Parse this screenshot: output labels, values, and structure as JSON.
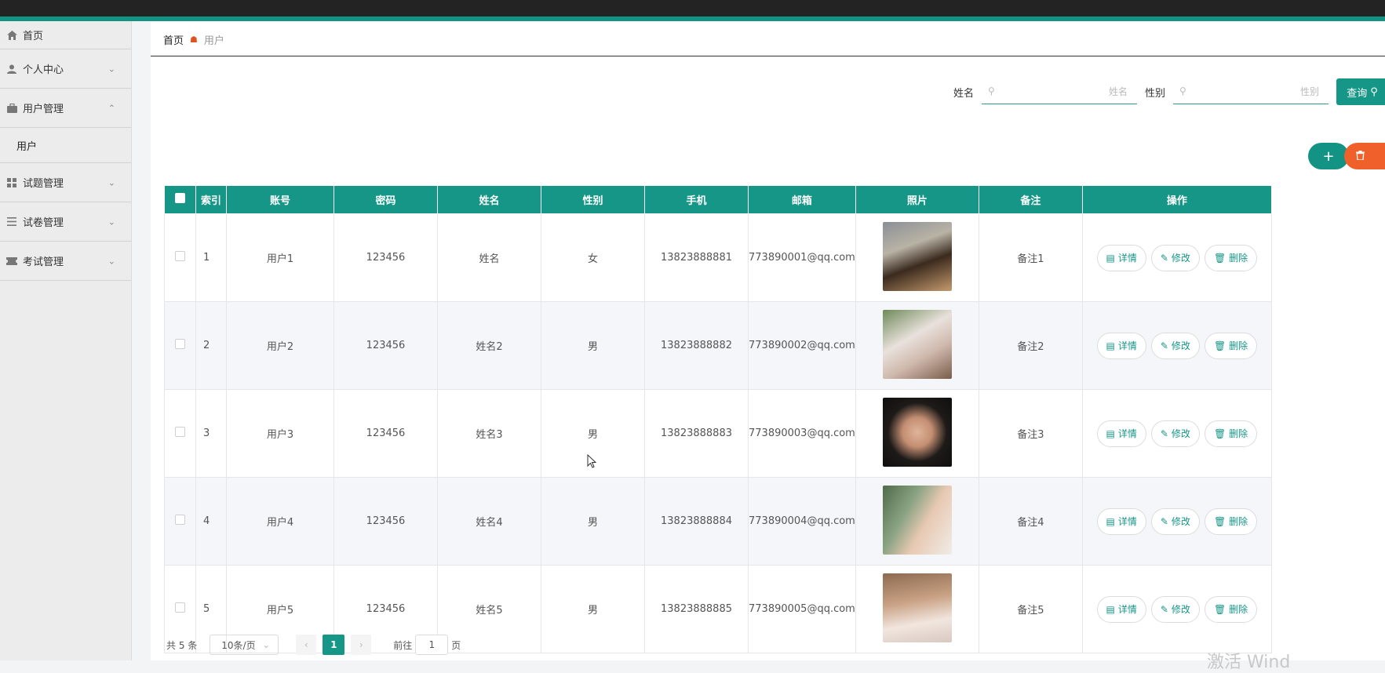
{
  "sidebar": {
    "home": "首页",
    "personal": "个人中心",
    "user_mgmt": "用户管理",
    "user_sub": "用户",
    "question_mgmt": "试题管理",
    "paper_mgmt": "试卷管理",
    "exam_mgmt": "考试管理"
  },
  "breadcrumb": {
    "home": "首页",
    "current": "用户"
  },
  "search": {
    "name_label": "姓名",
    "name_placeholder": "姓名",
    "gender_label": "性别",
    "gender_placeholder": "性别",
    "query_label": "查询"
  },
  "actions": {
    "add": "+"
  },
  "table": {
    "headers": [
      "索引",
      "账号",
      "密码",
      "姓名",
      "性别",
      "手机",
      "邮箱",
      "照片",
      "备注",
      "操作"
    ],
    "op_labels": {
      "detail": "详情",
      "edit": "修改",
      "delete": "删除"
    },
    "rows": [
      {
        "index": "1",
        "account": "用户1",
        "password": "123456",
        "name": "姓名",
        "gender": "女",
        "phone": "13823888881",
        "email": "773890001@qq.com",
        "remark": "备注1"
      },
      {
        "index": "2",
        "account": "用户2",
        "password": "123456",
        "name": "姓名2",
        "gender": "男",
        "phone": "13823888882",
        "email": "773890002@qq.com",
        "remark": "备注2"
      },
      {
        "index": "3",
        "account": "用户3",
        "password": "123456",
        "name": "姓名3",
        "gender": "男",
        "phone": "13823888883",
        "email": "773890003@qq.com",
        "remark": "备注3"
      },
      {
        "index": "4",
        "account": "用户4",
        "password": "123456",
        "name": "姓名4",
        "gender": "男",
        "phone": "13823888884",
        "email": "773890004@qq.com",
        "remark": "备注4"
      },
      {
        "index": "5",
        "account": "用户5",
        "password": "123456",
        "name": "姓名5",
        "gender": "男",
        "phone": "13823888885",
        "email": "773890005@qq.com",
        "remark": "备注5"
      }
    ]
  },
  "pagination": {
    "total": "共 5 条",
    "page_size": "10条/页",
    "current_page": "1",
    "goto_prefix": "前往",
    "goto_value": "1",
    "goto_suffix": "页"
  },
  "watermark": "激活 Wind",
  "colors": {
    "accent": "#159687",
    "danger": "#f0602b",
    "topbar": "#232323"
  }
}
